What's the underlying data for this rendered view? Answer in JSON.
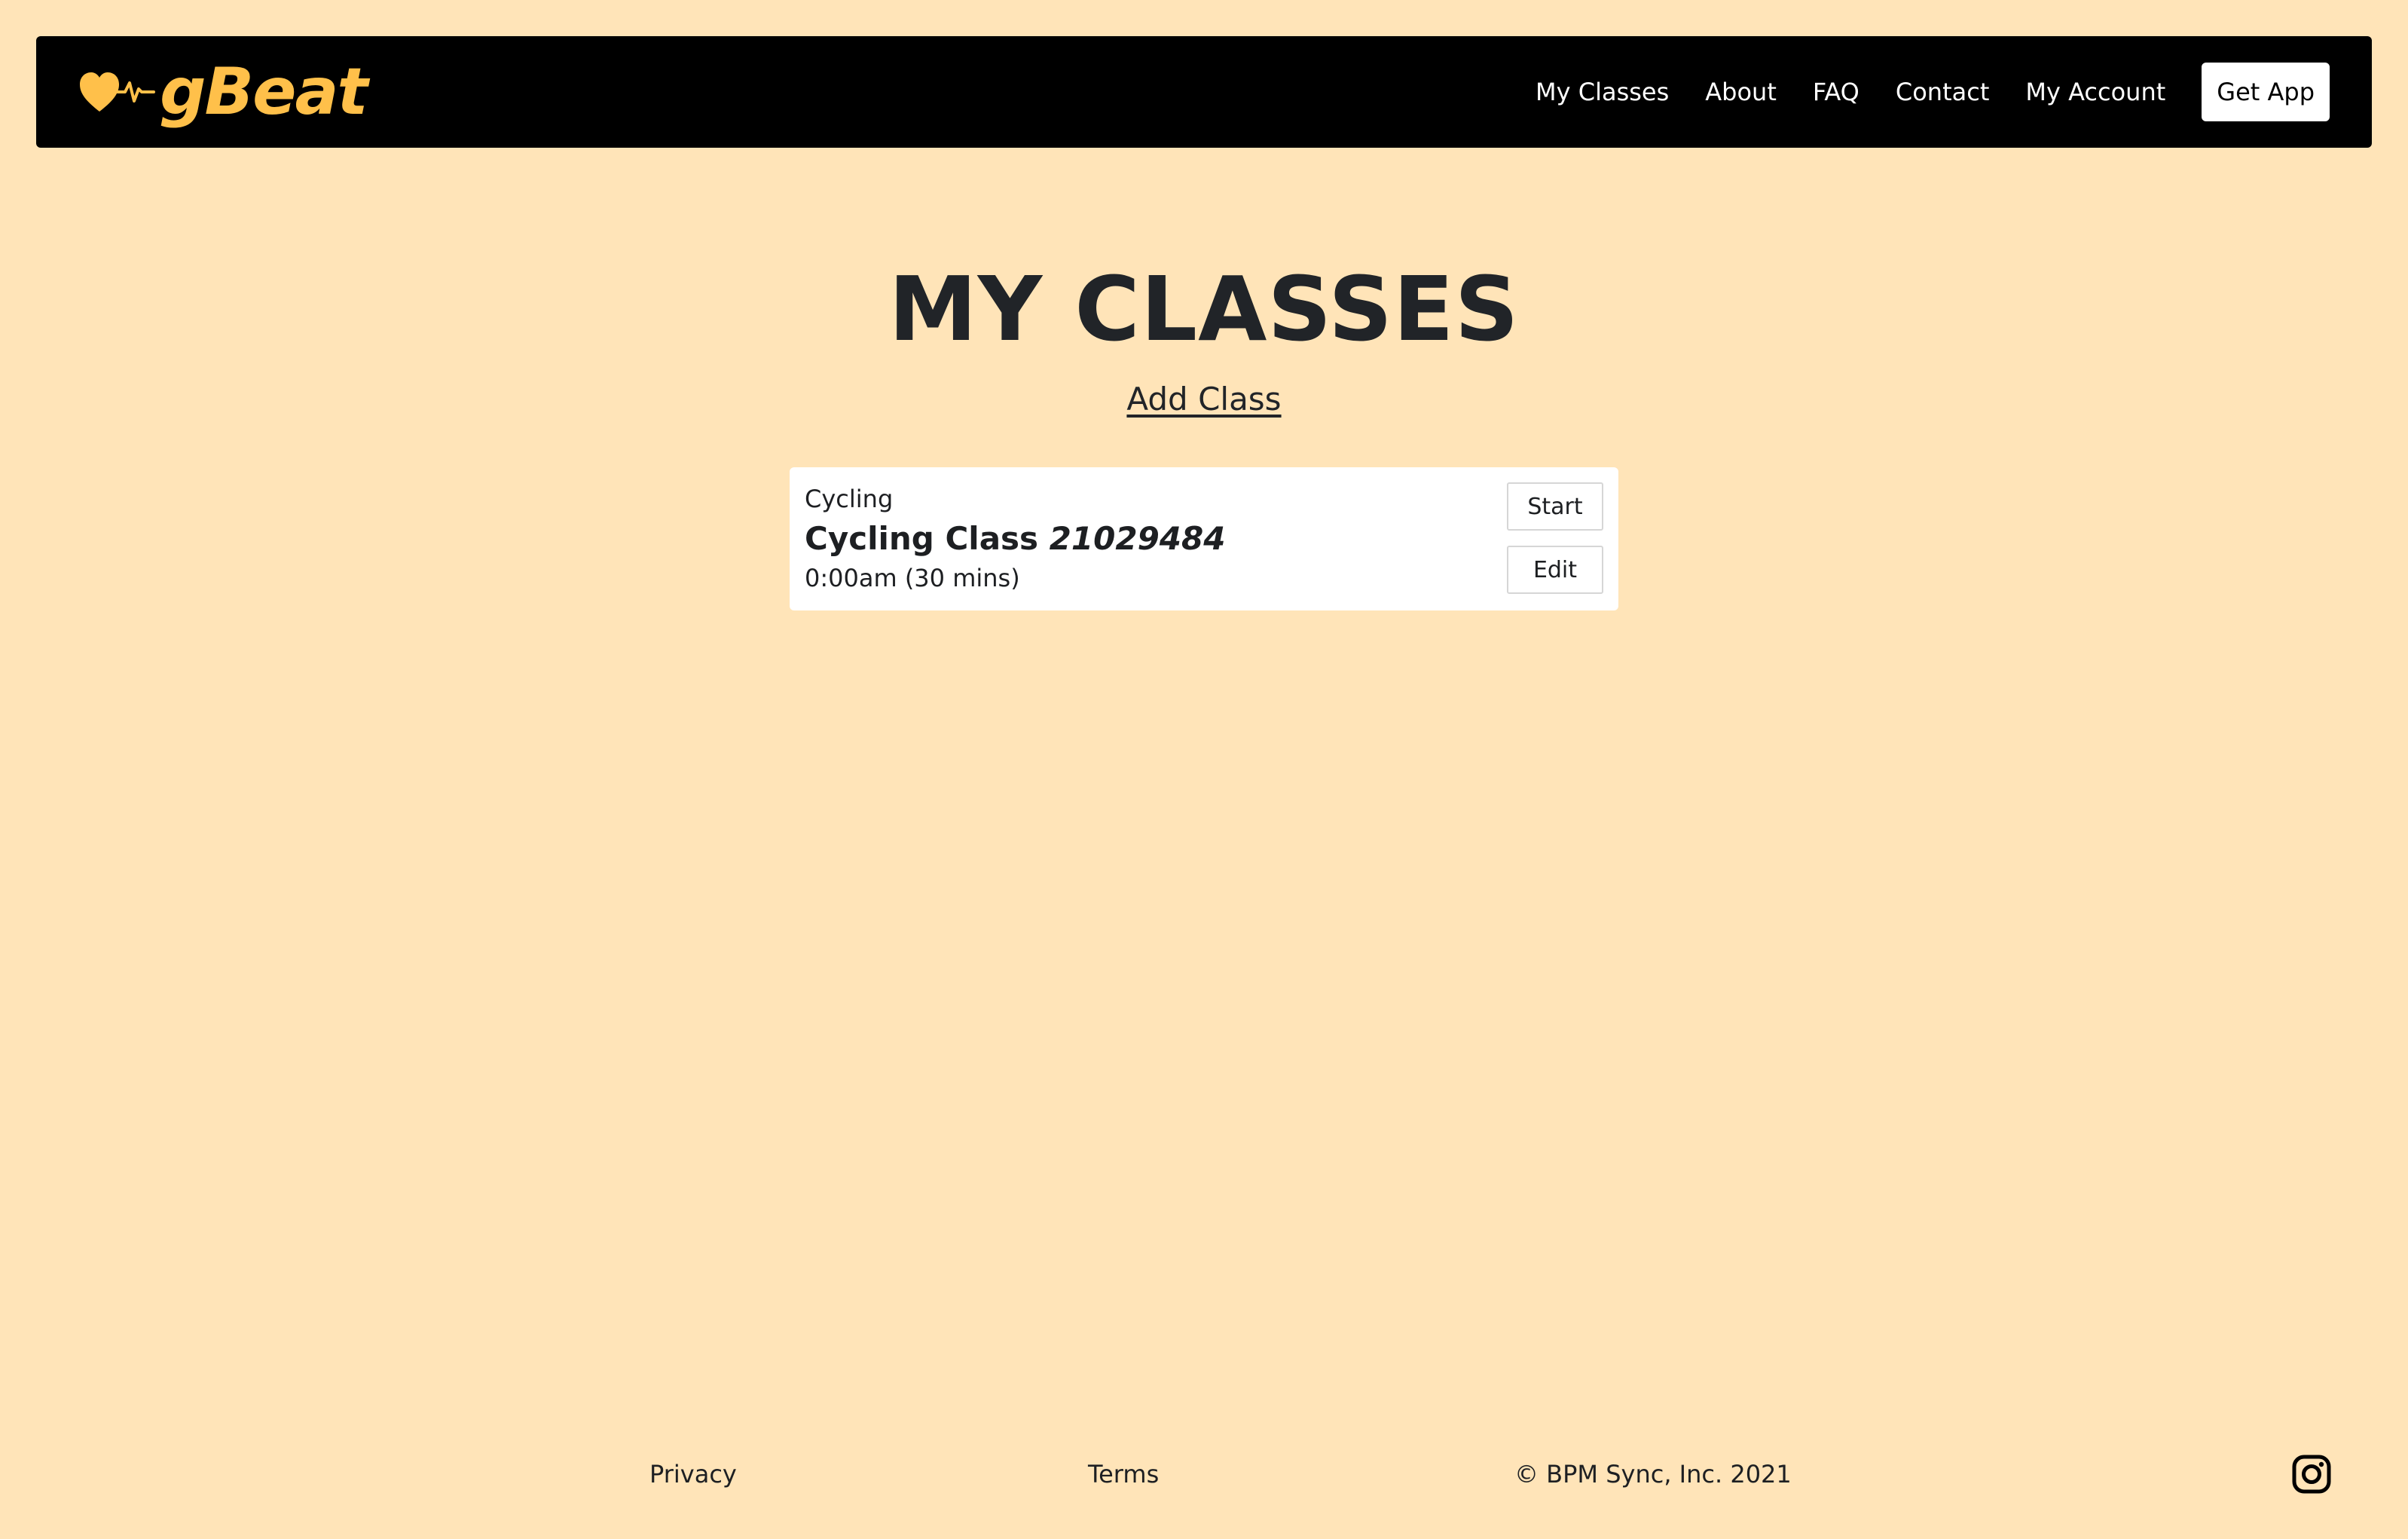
{
  "brand": {
    "name": "gBeat",
    "accent": "#ffc04a",
    "logo_icon": "heart-pulse-icon"
  },
  "nav": {
    "links": [
      "My Classes",
      "About",
      "FAQ",
      "Contact",
      "My Account"
    ],
    "cta": "Get App"
  },
  "main": {
    "title": "MY CLASSES",
    "add_class": "Add Class",
    "classes": [
      {
        "category": "Cycling",
        "name": "Cycling Class",
        "number": "21029484",
        "time": "0:00am (30 mins)",
        "start_label": "Start",
        "edit_label": "Edit"
      }
    ]
  },
  "footer": {
    "privacy": "Privacy",
    "terms": "Terms",
    "copyright": "© BPM Sync, Inc. 2021",
    "social_icon": "instagram-icon"
  },
  "colors": {
    "background": "#ffe4b8",
    "navbar": "#000000",
    "text": "#212428"
  }
}
